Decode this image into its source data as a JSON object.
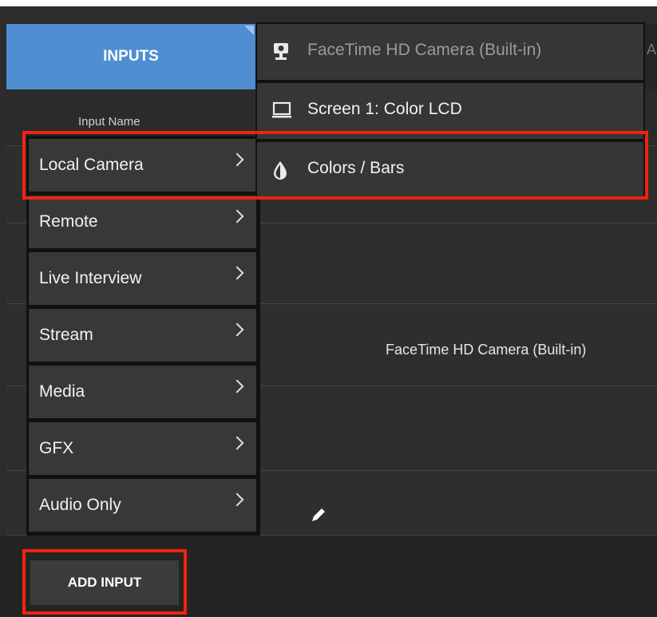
{
  "tabs": {
    "inputs": "INPUTS"
  },
  "table": {
    "column_header": "Input Name",
    "rows": [
      {
        "source": "FaceTime HD Camera (Built-in)"
      }
    ]
  },
  "menu": {
    "items": [
      {
        "label": "Local Camera"
      },
      {
        "label": "Remote"
      },
      {
        "label": "Live Interview"
      },
      {
        "label": "Stream"
      },
      {
        "label": "Media"
      },
      {
        "label": "GFX"
      },
      {
        "label": "Audio Only"
      }
    ]
  },
  "submenu": {
    "items": [
      {
        "label": "FaceTime HD Camera (Built-in)",
        "icon": "webcam-icon",
        "state": "disabled"
      },
      {
        "label": "Screen 1: Color LCD",
        "icon": "monitor-icon",
        "state": "enabled"
      },
      {
        "label": "Colors / Bars",
        "icon": "color-drop-icon",
        "state": "enabled"
      }
    ]
  },
  "footer": {
    "add_input_label": "ADD INPUT"
  },
  "header_edge_glyph": "A",
  "colors": {
    "tab_blue": "#4e8ed1",
    "highlight_red": "#f0230f",
    "menu_bg": "#383838"
  }
}
